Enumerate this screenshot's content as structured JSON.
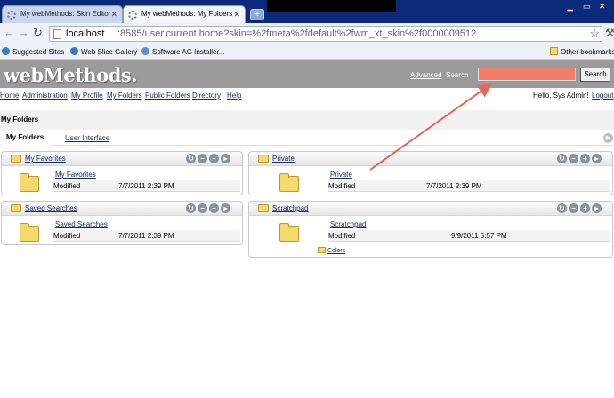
{
  "browser": {
    "tabs": [
      {
        "title": "My webMethods: Skin Editor"
      },
      {
        "title": "My webMethods: My Folders"
      }
    ],
    "new_tab_label": "+",
    "url_host": "localhost",
    "url_rest": ":8585/user.current.home?skin=%2fmeta%2fdefault%2fwm_xt_skin%2f0000009512",
    "bookmarks": [
      "Suggested Sites",
      "Web Slice Gallery",
      "Software AG Installer...",
      "Other bookmarks"
    ]
  },
  "header": {
    "logo": "webMethods.",
    "advanced_link": "Advanced",
    "search_label": "Search",
    "search_value": "",
    "search_button": "Search"
  },
  "menu": {
    "items": [
      "Home",
      "Administration",
      "My Profile",
      "My Folders",
      "Public Folders",
      "Directory",
      "Help"
    ],
    "greeting": "Hello, Sys Admin!",
    "logout": "Logout"
  },
  "page": {
    "title": "My Folders",
    "tabs": [
      "My Folders",
      "User Interface"
    ]
  },
  "portlets": [
    {
      "title": "My Favorites",
      "item": "My Favorites",
      "label": "Modified",
      "date": "7/7/2011 2:39 PM"
    },
    {
      "title": "Private",
      "item": "Private",
      "label": "Modified",
      "date": "7/7/2011 2:39 PM"
    },
    {
      "title": "Saved Searches",
      "item": "Saved Searches",
      "label": "Modified",
      "date": "7/7/2011 2:39 PM"
    },
    {
      "title": "Scratchpad",
      "item": "Scratchpad",
      "label": "Modified",
      "date": "9/9/2011 5:57 PM",
      "subfolder": "Colors"
    }
  ],
  "colors": {
    "search_highlight": "#f47c6a",
    "annotation_arrow": "#e06a5a",
    "header_bg": "#9b9b9b"
  }
}
